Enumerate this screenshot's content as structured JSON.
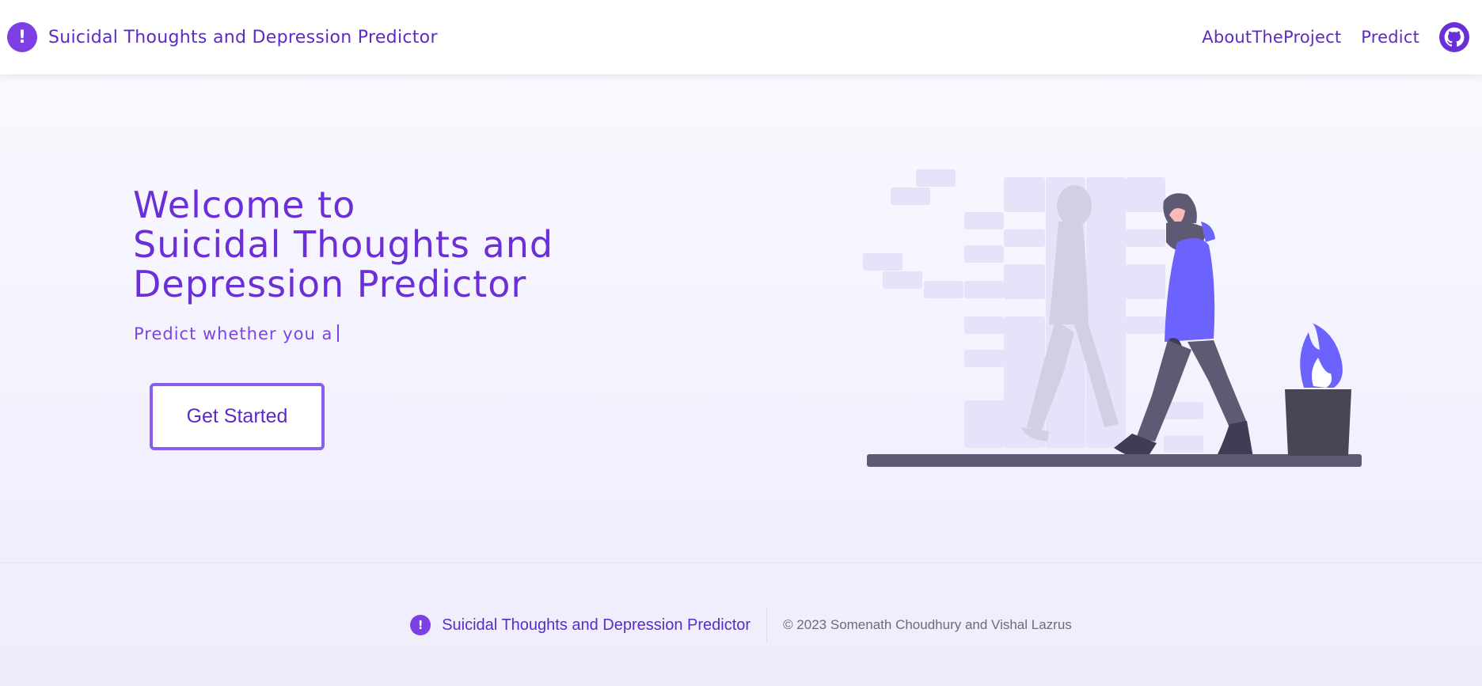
{
  "navbar": {
    "brand_icon": "!",
    "brand_title": "Suicidal Thoughts and Depression Predictor",
    "links": [
      {
        "label": "AboutTheProject"
      },
      {
        "label": "Predict"
      }
    ],
    "github_icon": "github-icon"
  },
  "hero": {
    "title_line1": "Welcome to",
    "title_line2": "Suicidal Thoughts and",
    "title_line3": "Depression Predictor",
    "typed_text": "Predict whether you a",
    "cta_label": "Get Started"
  },
  "footer": {
    "icon": "!",
    "title": "Suicidal Thoughts and Depression Predictor",
    "copyright": "© 2023 Somenath Choudhury and Vishal Lazrus"
  },
  "colors": {
    "primary": "#5b2bc7",
    "accent": "#7b3fe4",
    "illustration_blue": "#6c63ff",
    "illustration_dark": "#464657"
  }
}
